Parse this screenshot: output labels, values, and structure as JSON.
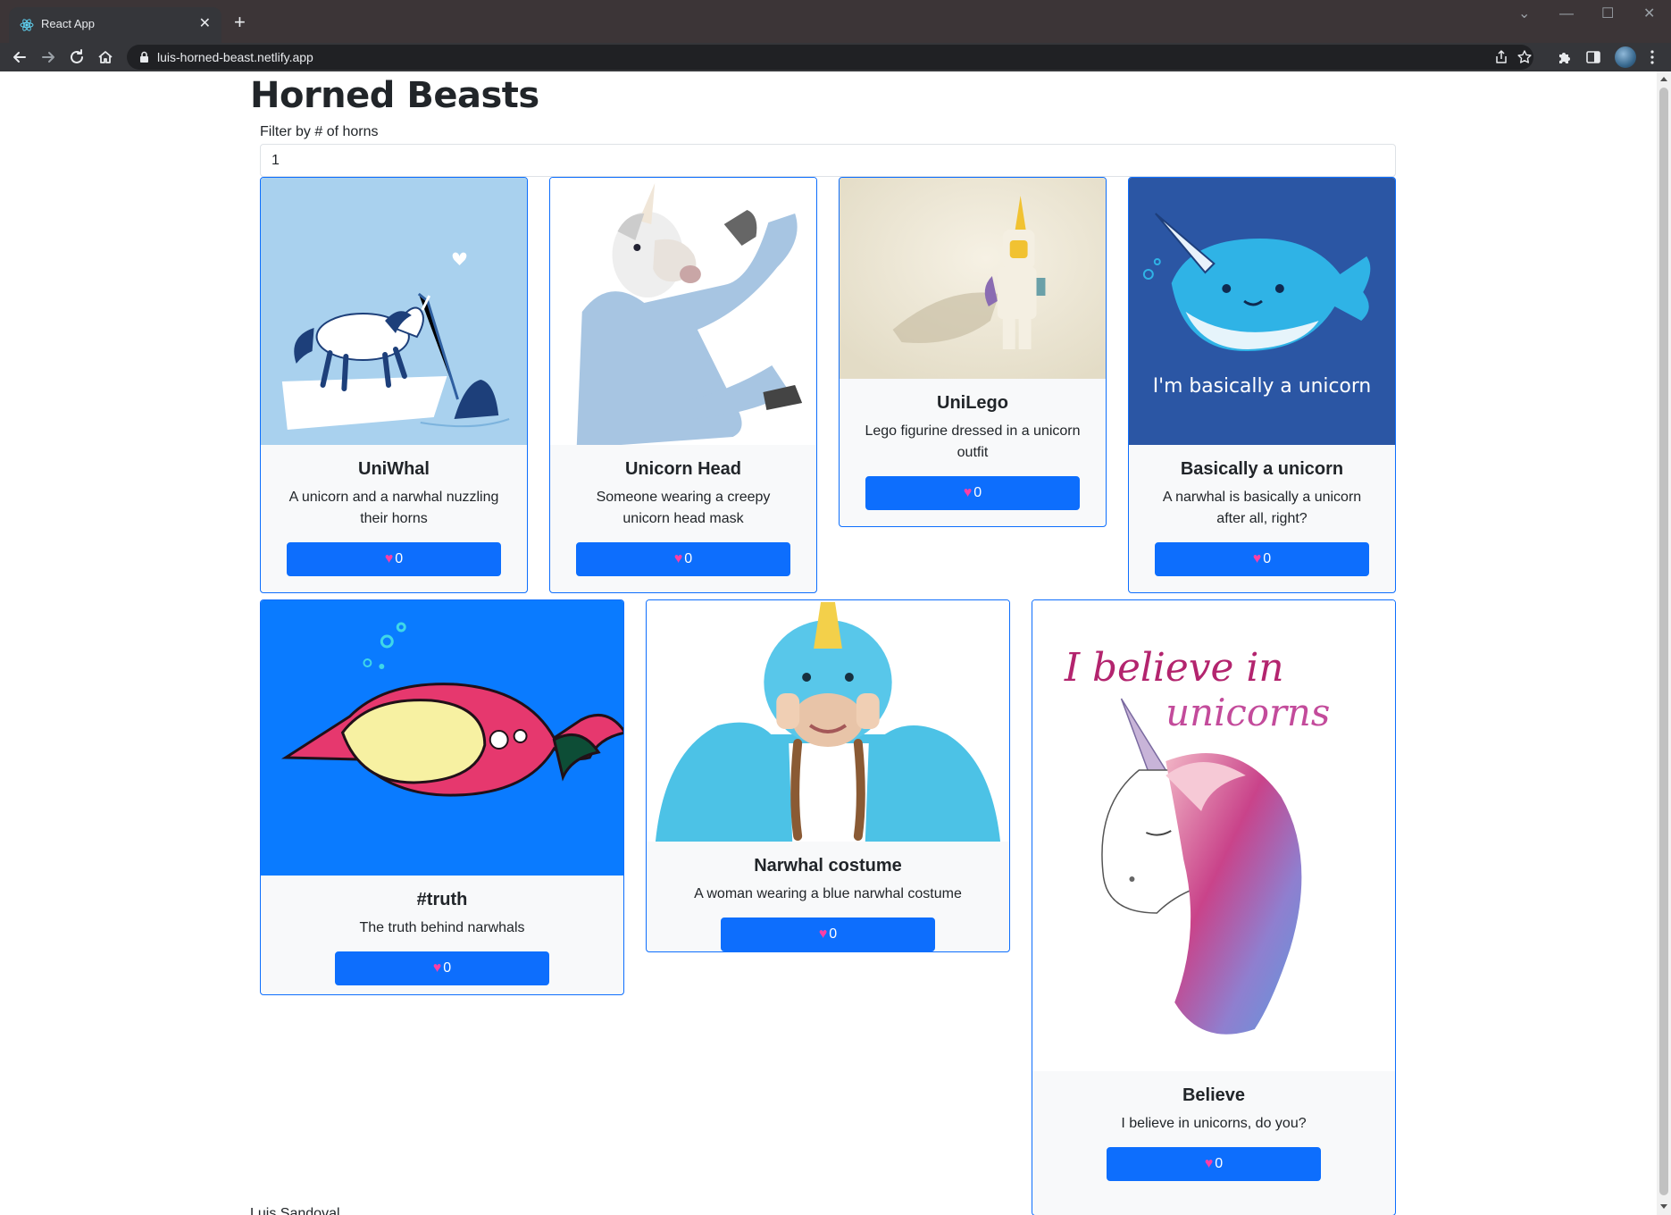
{
  "browser": {
    "tab_title": "React App",
    "tab_close": "✕",
    "new_tab": "+",
    "url": "luis-horned-beast.netlify.app",
    "minimize": "—",
    "maximize": "☐",
    "close": "✕",
    "collapse": "⌄"
  },
  "page": {
    "title": "Horned Beasts",
    "filter_label": "Filter by # of horns",
    "filter_value": "1",
    "footer": "Luis Sandoval"
  },
  "colors": {
    "primary": "#0d6efd",
    "card_background": "#f8f9fa",
    "heart": "#ff3ea5"
  },
  "heart_icon": "♥",
  "beasts": [
    {
      "title": "UniWhal",
      "description": "A unicorn and a narwhal nuzzling their horns",
      "likes": "0"
    },
    {
      "title": "Unicorn Head",
      "description": "Someone wearing a creepy unicorn head mask",
      "likes": "0"
    },
    {
      "title": "UniLego",
      "description": "Lego figurine dressed in a unicorn outfit",
      "likes": "0"
    },
    {
      "title": "Basically a unicorn",
      "description": "A narwhal is basically a unicorn after all, right?",
      "likes": "0",
      "image_text": "I'm basically a unicorn"
    },
    {
      "title": "#truth",
      "description": "The truth behind narwhals",
      "likes": "0"
    },
    {
      "title": "Narwhal costume",
      "description": "A woman wearing a blue narwhal costume",
      "likes": "0"
    },
    {
      "title": "Believe",
      "description": "I believe in unicorns, do you?",
      "likes": "0",
      "image_text_1": "I believe in",
      "image_text_2": "unicorns"
    }
  ]
}
